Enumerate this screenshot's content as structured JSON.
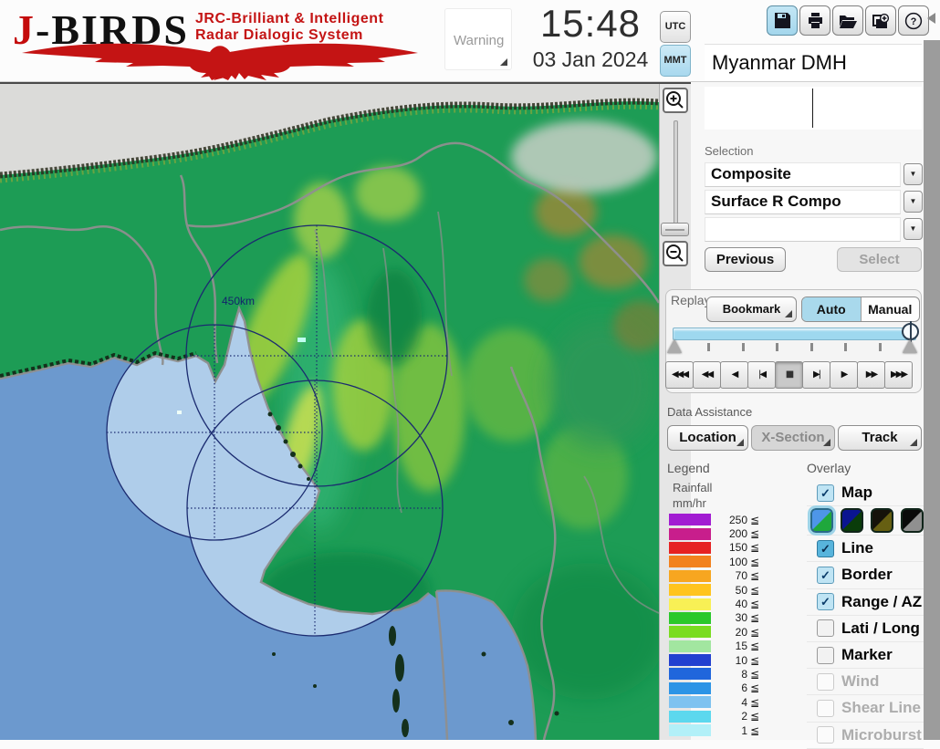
{
  "header": {
    "logo": {
      "title_first_letter": "J",
      "title_rest": "-BIRDS",
      "subtitle_line1": "JRC-Brilliant & Intelligent",
      "subtitle_line2": "Radar  Dialogic  System"
    },
    "warning_button": "Warning",
    "clock": {
      "time": "15:48",
      "date": "03 Jan 2024"
    },
    "timezone": {
      "options": [
        "UTC",
        "MMT"
      ],
      "selected": "MMT"
    },
    "toolbar": [
      {
        "name": "save-icon",
        "active": true
      },
      {
        "name": "print-icon",
        "active": false
      },
      {
        "name": "open-folder-icon",
        "active": false
      },
      {
        "name": "add-image-icon",
        "active": false
      },
      {
        "name": "help-icon",
        "active": false
      }
    ]
  },
  "panel": {
    "site_name": "Myanmar DMH",
    "selection": {
      "label": "Selection",
      "dropdowns": [
        "Composite",
        "Surface R Compo",
        ""
      ],
      "previous_button": "Previous",
      "select_button": "Select"
    },
    "replay": {
      "label": "Replay",
      "bookmark_button": "Bookmark",
      "mode_options": [
        "Auto",
        "Manual"
      ],
      "mode_selected": "Auto",
      "slider": {
        "value_percent": 100,
        "tick_count": 6
      },
      "playback_buttons": [
        {
          "name": "rewind-fast-button",
          "glyph": "◀◀◀",
          "active": false
        },
        {
          "name": "rewind-button",
          "glyph": "◀◀",
          "active": false
        },
        {
          "name": "play-reverse-button",
          "glyph": "◀",
          "active": false
        },
        {
          "name": "skip-start-button",
          "glyph": "|◀",
          "active": false
        },
        {
          "name": "stop-button",
          "glyph": "■",
          "active": true
        },
        {
          "name": "skip-end-button",
          "glyph": "▶|",
          "active": false
        },
        {
          "name": "play-button",
          "glyph": "▶",
          "active": false
        },
        {
          "name": "forward-button",
          "glyph": "▶▶",
          "active": false
        },
        {
          "name": "forward-fast-button",
          "glyph": "▶▶▶",
          "active": false
        }
      ]
    },
    "data_assistance": {
      "label": "Data Assistance",
      "buttons": [
        {
          "label": "Location",
          "enabled": true
        },
        {
          "label": "X-Section",
          "enabled": false
        },
        {
          "label": "Track",
          "enabled": true
        }
      ]
    },
    "legend": {
      "label": "Legend",
      "title_line1": "Rainfall",
      "title_line2": "mm/hr",
      "comparator": "≦",
      "items": [
        {
          "value": "250",
          "color": "#A21CD2"
        },
        {
          "value": "200",
          "color": "#C81E8C"
        },
        {
          "value": "150",
          "color": "#E62222"
        },
        {
          "value": "100",
          "color": "#F2821E"
        },
        {
          "value": "70",
          "color": "#F7A620"
        },
        {
          "value": "50",
          "color": "#FFC41E"
        },
        {
          "value": "40",
          "color": "#F8F055"
        },
        {
          "value": "30",
          "color": "#2AC82A"
        },
        {
          "value": "20",
          "color": "#7ADC20"
        },
        {
          "value": "15",
          "color": "#A2E6A0"
        },
        {
          "value": "10",
          "color": "#2240D0"
        },
        {
          "value": "8",
          "color": "#2066DC"
        },
        {
          "value": "6",
          "color": "#2C94E6"
        },
        {
          "value": "4",
          "color": "#7EC2F0"
        },
        {
          "value": "2",
          "color": "#5CD8EE"
        },
        {
          "value": "1",
          "color": "#B2F0F8"
        }
      ]
    },
    "overlay": {
      "label": "Overlay",
      "map_styles": {
        "selected_index": 0,
        "swatches": [
          {
            "top": "#4E96E8",
            "bottom": "#1FA83C"
          },
          {
            "top": "#0A1490",
            "bottom": "#0A3C0A"
          },
          {
            "top": "#15120A",
            "bottom": "#665F12"
          },
          {
            "top": "#0A0A0A",
            "bottom": "#909090"
          }
        ]
      },
      "items": [
        {
          "label": "Map",
          "state": "checked",
          "focus": false
        },
        {
          "label": "Line",
          "state": "checked",
          "focus": true
        },
        {
          "label": "Border",
          "state": "checked",
          "focus": false
        },
        {
          "label": "Range / AZ",
          "state": "checked",
          "focus": false
        },
        {
          "label": "Lati / Long",
          "state": "unchecked",
          "focus": false
        },
        {
          "label": "Marker",
          "state": "unchecked",
          "focus": false
        },
        {
          "label": "Wind",
          "state": "disabled",
          "focus": false
        },
        {
          "label": "Shear Line",
          "state": "disabled",
          "focus": false
        },
        {
          "label": "Microburst",
          "state": "disabled",
          "focus": false
        }
      ]
    }
  },
  "map": {
    "range_ring_label": "450km",
    "colors": {
      "sea": "#6C99CE",
      "sea_in_range": "#AFCDEA",
      "land": "#1D9C55",
      "plateau": "#DBDBD9",
      "ring_outline": "#1B2B70",
      "border_line": "#8F8F8F"
    }
  }
}
